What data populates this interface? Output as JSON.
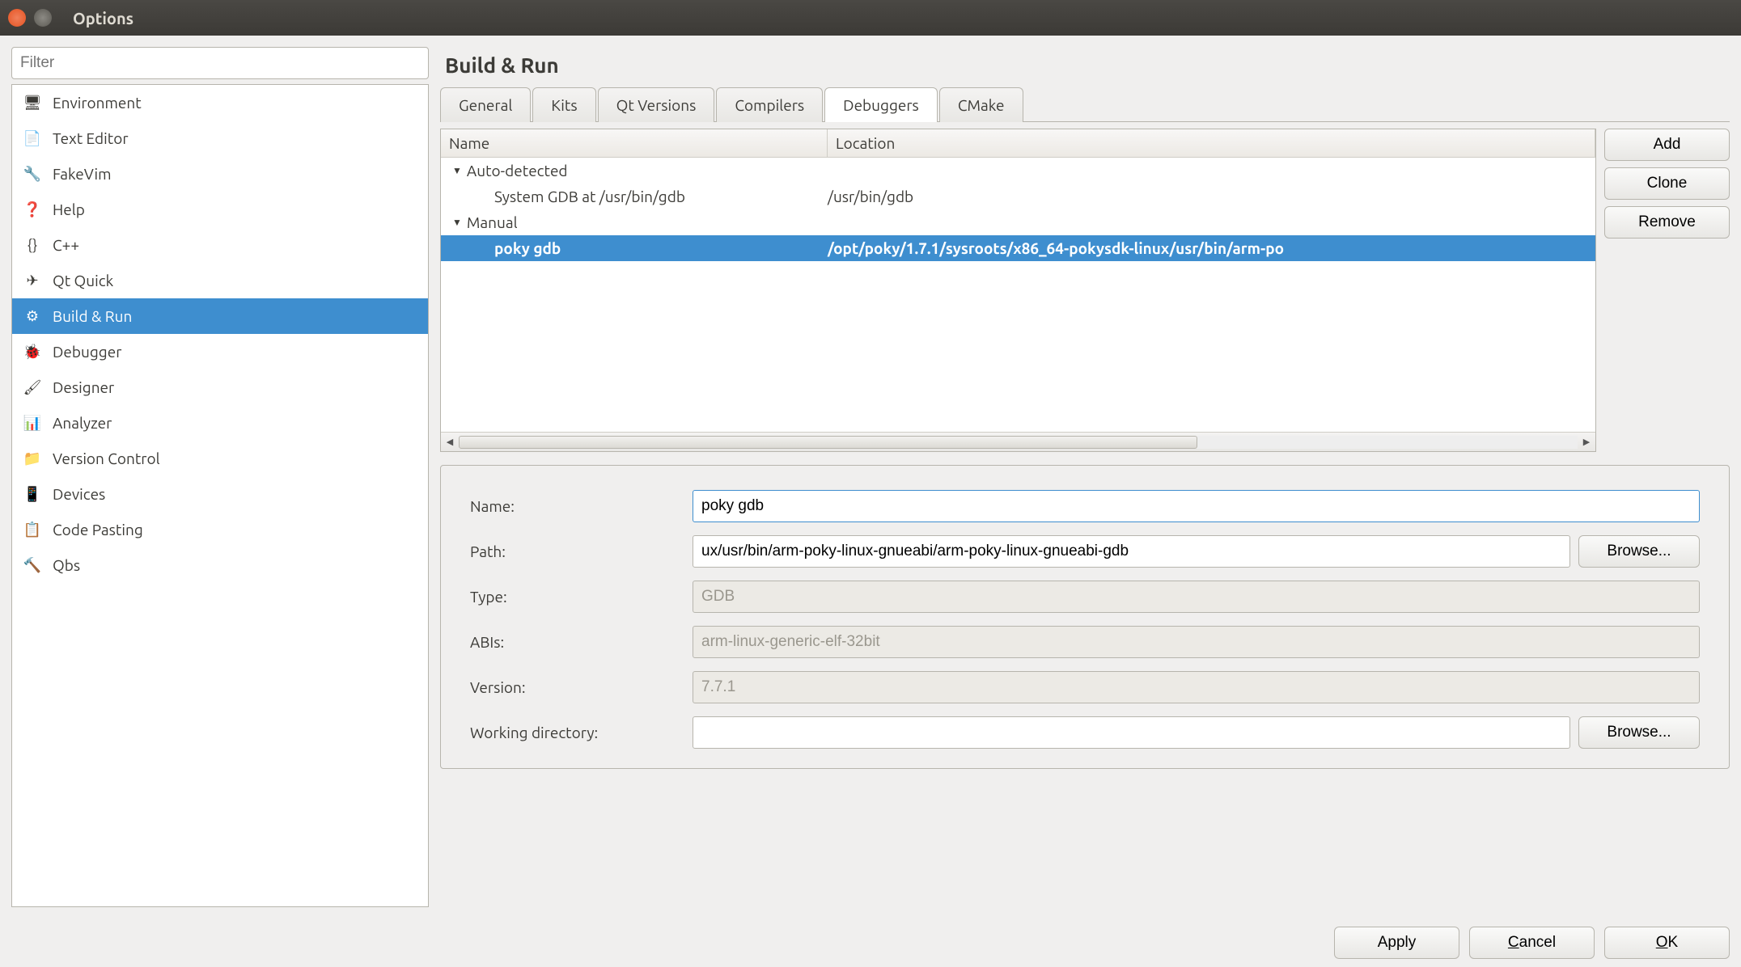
{
  "window": {
    "title": "Options"
  },
  "filter": {
    "placeholder": "Filter"
  },
  "sidebar": {
    "items": [
      {
        "label": "Environment",
        "icon": "monitor-icon"
      },
      {
        "label": "Text Editor",
        "icon": "text-editor-icon"
      },
      {
        "label": "FakeVim",
        "icon": "fakevim-icon"
      },
      {
        "label": "Help",
        "icon": "help-icon"
      },
      {
        "label": "C++",
        "icon": "cpp-icon"
      },
      {
        "label": "Qt Quick",
        "icon": "qtquick-icon"
      },
      {
        "label": "Build & Run",
        "icon": "buildrun-icon",
        "selected": true
      },
      {
        "label": "Debugger",
        "icon": "debugger-icon"
      },
      {
        "label": "Designer",
        "icon": "designer-icon"
      },
      {
        "label": "Analyzer",
        "icon": "analyzer-icon"
      },
      {
        "label": "Version Control",
        "icon": "vcs-icon"
      },
      {
        "label": "Devices",
        "icon": "devices-icon"
      },
      {
        "label": "Code Pasting",
        "icon": "codepaste-icon"
      },
      {
        "label": "Qbs",
        "icon": "qbs-icon"
      }
    ]
  },
  "panel": {
    "title": "Build & Run",
    "tabs": [
      {
        "label": "General"
      },
      {
        "label": "Kits"
      },
      {
        "label": "Qt Versions"
      },
      {
        "label": "Compilers"
      },
      {
        "label": "Debuggers",
        "active": true
      },
      {
        "label": "CMake"
      }
    ]
  },
  "tree": {
    "headers": {
      "name": "Name",
      "location": "Location"
    },
    "groups": [
      {
        "label": "Auto-detected",
        "rows": [
          {
            "name": "System GDB at /usr/bin/gdb",
            "location": "/usr/bin/gdb"
          }
        ]
      },
      {
        "label": "Manual",
        "rows": [
          {
            "name": "poky gdb",
            "location": "/opt/poky/1.7.1/sysroots/x86_64-pokysdk-linux/usr/bin/arm-po",
            "selected": true
          }
        ]
      }
    ]
  },
  "actions": {
    "add": "Add",
    "clone": "Clone",
    "remove": "Remove"
  },
  "form": {
    "name": {
      "label": "Name:",
      "value": "poky gdb"
    },
    "path": {
      "label": "Path:",
      "value": "ux/usr/bin/arm-poky-linux-gnueabi/arm-poky-linux-gnueabi-gdb",
      "browse": "Browse..."
    },
    "type": {
      "label": "Type:",
      "value": "GDB"
    },
    "abis": {
      "label": "ABIs:",
      "value": "arm-linux-generic-elf-32bit"
    },
    "version": {
      "label": "Version:",
      "value": "7.7.1"
    },
    "workdir": {
      "label": "Working directory:",
      "value": "",
      "browse": "Browse..."
    }
  },
  "footer": {
    "apply": "Apply",
    "cancel": "Cancel",
    "ok": "OK"
  }
}
